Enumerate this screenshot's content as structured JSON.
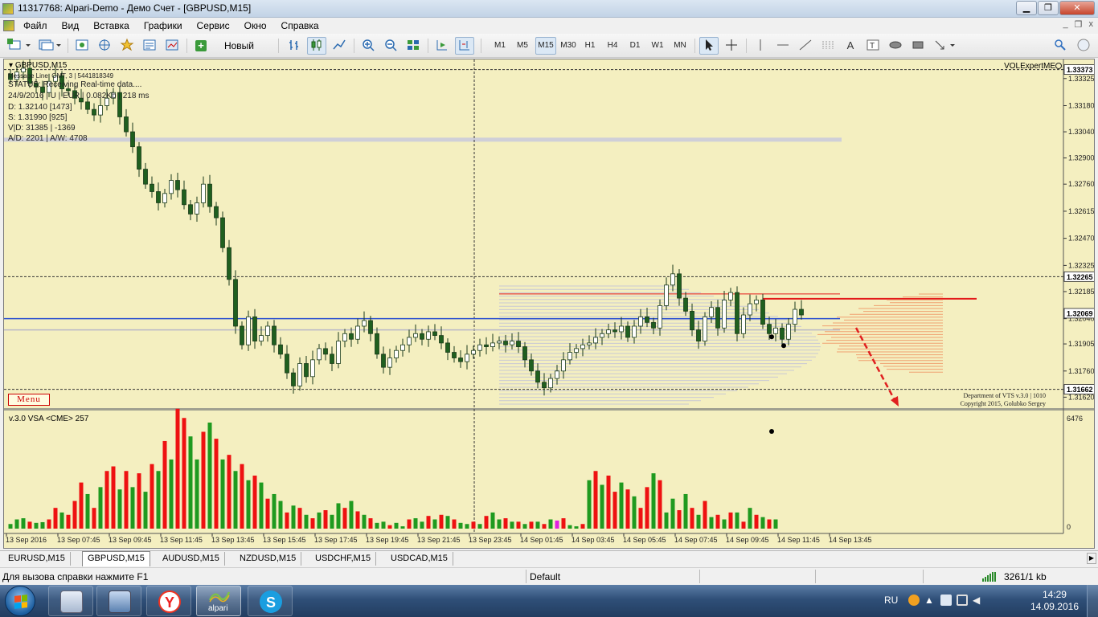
{
  "window": {
    "title": "11317768: Alpari-Demo - Демо Счет - [GBPUSD,M15]",
    "minimize": "▁",
    "restore": "❐",
    "close": "✕"
  },
  "menu": {
    "items": [
      "Файл",
      "Вид",
      "Вставка",
      "Графики",
      "Сервис",
      "Окно",
      "Справка"
    ],
    "mdi_min": "_",
    "mdi_restore": "❐",
    "mdi_close": "x"
  },
  "toolbar": {
    "new_order": "Новый ордер",
    "timeframes": [
      "M1",
      "M5",
      "M15",
      "M30",
      "H1",
      "H4",
      "D1",
      "W1",
      "MN"
    ],
    "selected_timeframe": "M15",
    "text_tool": "A",
    "text_label_tool": "T",
    "search_icon": "search-icon"
  },
  "chart": {
    "title": "GBPUSD,M15",
    "info_lines": [
      "Message Line: GMT, 3 | 5441818349",
      "STATUS: Receiving Real-time data....",
      "24/9/2016 | U | EUR | 0.082Kb | 218 ms",
      "D: 1.32140  [1473]",
      "S: 1.31990  [925]",
      "V|D: 31385 | -1369",
      "A/D: 2201 | A/W: 4708"
    ],
    "expert": "VOLExpertME",
    "menu_button": "Menu",
    "copyright_1": "Department of VTS  v.3.0 | 1010",
    "copyright_2": "Copyright 2015, Golubko Sergey",
    "subwindow_title": "v.3.0 VSA <CME> 257",
    "subwindow_max": "6476",
    "subwindow_min": "0",
    "price_labels": [
      "1.33325",
      "1.33180",
      "1.33040",
      "1.32900",
      "1.32760",
      "1.32615",
      "1.32470",
      "1.32325",
      "1.32185",
      "1.32040",
      "1.31905",
      "1.31760",
      "1.31620"
    ],
    "highlight_labels": [
      {
        "text": "1.33373",
        "price": 1.33373
      },
      {
        "text": "1.32265",
        "price": 1.32265
      },
      {
        "text": "1.32069",
        "price": 1.32069
      },
      {
        "text": "1.31662",
        "price": 1.31662
      }
    ],
    "time_labels": [
      "13 Sep 2016",
      "13 Sep 07:45",
      "13 Sep 09:45",
      "13 Sep 11:45",
      "13 Sep 13:45",
      "13 Sep 15:45",
      "13 Sep 17:45",
      "13 Sep 19:45",
      "13 Sep 21:45",
      "13 Sep 23:45",
      "14 Sep 01:45",
      "14 Sep 03:45",
      "14 Sep 05:45",
      "14 Sep 07:45",
      "14 Sep 09:45",
      "14 Sep 11:45",
      "14 Sep 13:45"
    ],
    "colors": {
      "background": "#f4efc0",
      "candle_up": "#ffffff",
      "candle_down": "#1f5f1f",
      "volume_up": "#1f9a1f",
      "volume_down": "#ee1111",
      "blue_line": "#2a4fd0",
      "red_line": "#e31a1a",
      "profile": "#f0a070"
    }
  },
  "chart_data": {
    "type": "candlestick",
    "title": "GBPUSD,M15",
    "ylim": [
      1.3157,
      1.3341
    ],
    "levels": {
      "top_dashed": 1.33373,
      "upper_dashed": 1.32265,
      "current_price": 1.32069,
      "bottom_dashed": 1.31662,
      "blue_line": 1.3204,
      "red_line": 1.32155,
      "grey_upper": 1.33
    },
    "close_path": [
      1.3332,
      1.3336,
      1.3338,
      1.333,
      1.3328,
      1.3325,
      1.3331,
      1.3334,
      1.3327,
      1.3326,
      1.3322,
      1.332,
      1.3316,
      1.3313,
      1.3318,
      1.3322,
      1.3325,
      1.3312,
      1.3304,
      1.3296,
      1.3284,
      1.3276,
      1.3272,
      1.3266,
      1.3271,
      1.3278,
      1.3273,
      1.3265,
      1.326,
      1.3266,
      1.3276,
      1.3264,
      1.3258,
      1.3242,
      1.3225,
      1.32,
      1.319,
      1.3205,
      1.3192,
      1.3195,
      1.32,
      1.319,
      1.3185,
      1.3175,
      1.3168,
      1.318,
      1.3173,
      1.3182,
      1.3188,
      1.3185,
      1.318,
      1.3192,
      1.3196,
      1.3193,
      1.32,
      1.3203,
      1.3196,
      1.3185,
      1.3178,
      1.3183,
      1.3187,
      1.319,
      1.3194,
      1.3196,
      1.3193,
      1.3197,
      1.3195,
      1.3191,
      1.3186,
      1.3183,
      1.3181,
      1.3185,
      1.3187,
      1.319,
      1.3189,
      1.3191,
      1.3192,
      1.319,
      1.3192,
      1.3189,
      1.3182,
      1.3176,
      1.317,
      1.3167,
      1.3172,
      1.3176,
      1.3182,
      1.3186,
      1.3188,
      1.319,
      1.3191,
      1.3194,
      1.3196,
      1.3198,
      1.3197,
      1.32,
      1.3194,
      1.32,
      1.3205,
      1.3202,
      1.3199,
      1.3211,
      1.3222,
      1.3228,
      1.3215,
      1.3208,
      1.3198,
      1.3192,
      1.3205,
      1.321,
      1.3199,
      1.3214,
      1.3218,
      1.3196,
      1.3206,
      1.3212,
      1.3214,
      1.3201,
      1.3196,
      1.3199,
      1.3193,
      1.3201,
      1.3209,
      1.3206
    ],
    "volumes": [
      20,
      40,
      45,
      30,
      25,
      28,
      40,
      90,
      70,
      60,
      120,
      200,
      150,
      90,
      180,
      250,
      270,
      170,
      250,
      180,
      240,
      160,
      280,
      250,
      380,
      300,
      520,
      480,
      400,
      300,
      420,
      460,
      390,
      300,
      320,
      250,
      280,
      210,
      230,
      200,
      130,
      150,
      120,
      70,
      100,
      90,
      60,
      45,
      70,
      80,
      60,
      110,
      90,
      120,
      75,
      60,
      45,
      25,
      30,
      15,
      25,
      10,
      40,
      45,
      30,
      55,
      40,
      60,
      55,
      40,
      25,
      20,
      30,
      20,
      55,
      70,
      40,
      45,
      30,
      30,
      20,
      30,
      30,
      20,
      40,
      35,
      45,
      15,
      10,
      20,
      210,
      250,
      190,
      230,
      160,
      200,
      170,
      140,
      90,
      180,
      240,
      210,
      70,
      130,
      80,
      150,
      90,
      60,
      120,
      50,
      60,
      40,
      70,
      70,
      30,
      90,
      60,
      50,
      40,
      40
    ],
    "volume_colors": [
      "g",
      "g",
      "g",
      "r",
      "g",
      "g",
      "r",
      "r",
      "g",
      "r",
      "r",
      "r",
      "g",
      "r",
      "g",
      "r",
      "r",
      "g",
      "r",
      "g",
      "r",
      "g",
      "r",
      "g",
      "r",
      "g",
      "r",
      "r",
      "g",
      "g",
      "r",
      "g",
      "r",
      "g",
      "r",
      "g",
      "r",
      "g",
      "r",
      "g",
      "r",
      "g",
      "g",
      "r",
      "g",
      "r",
      "g",
      "r",
      "g",
      "r",
      "g",
      "g",
      "r",
      "g",
      "r",
      "g",
      "r",
      "g",
      "g",
      "r",
      "g",
      "g",
      "r",
      "g",
      "g",
      "r",
      "g",
      "r",
      "g",
      "r",
      "g",
      "g",
      "r",
      "g",
      "r",
      "g",
      "g",
      "r",
      "g",
      "r",
      "g",
      "r",
      "g",
      "r",
      "g",
      "m",
      "r",
      "g",
      "g",
      "r",
      "g",
      "r",
      "g",
      "r",
      "r",
      "g",
      "r",
      "g",
      "r",
      "r",
      "g",
      "r",
      "g",
      "g",
      "r",
      "g",
      "r",
      "g",
      "r",
      "g",
      "r",
      "g",
      "r",
      "g",
      "r",
      "g",
      "r",
      "g",
      "r",
      "g"
    ],
    "subwindow_ylim": [
      0,
      6476
    ]
  },
  "tabs": [
    "EURUSD,M15",
    "GBPUSD,M15",
    "AUDUSD,M15",
    "NZDUSD,M15",
    "USDCHF,M15",
    "USDCAD,M15"
  ],
  "active_tab": "GBPUSD,M15",
  "status": {
    "help": "Для вызова справки нажмите F1",
    "profile": "Default",
    "connection": "3261/1 kb"
  },
  "taskbar": {
    "alpari_label": "alpari",
    "lang": "RU",
    "time": "14:29",
    "date": "14.09.2016"
  }
}
